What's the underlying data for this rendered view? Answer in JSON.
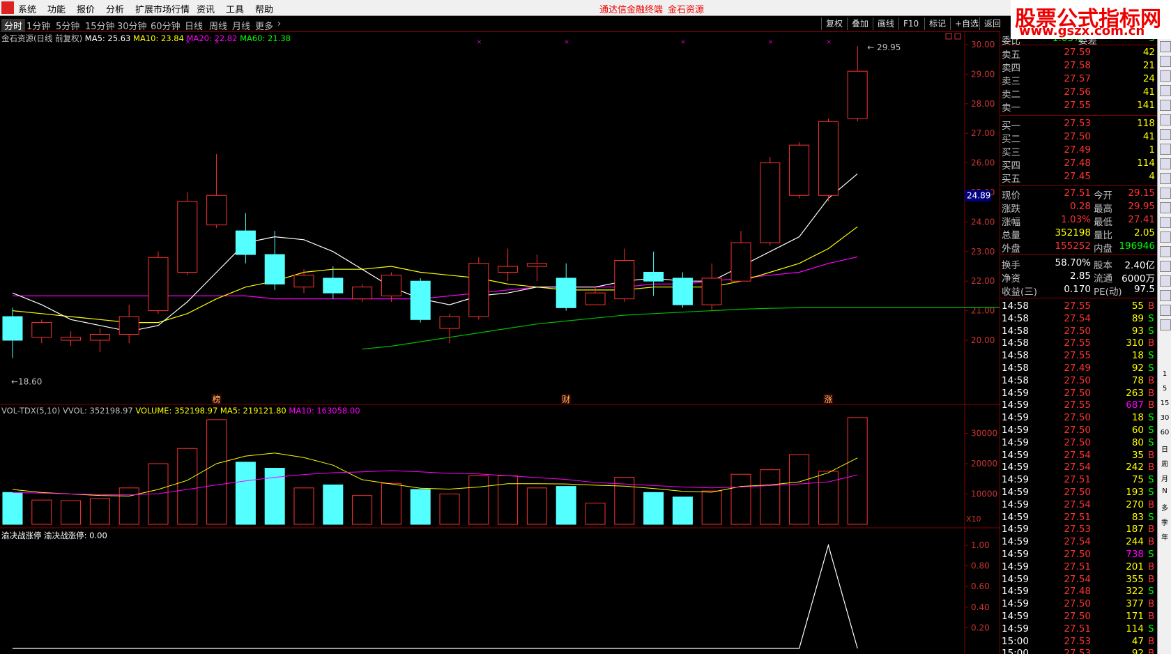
{
  "menu": [
    "系统",
    "功能",
    "报价",
    "分析",
    "扩展市场行情",
    "资讯",
    "工具",
    "帮助"
  ],
  "menu_center": [
    "通达信金融终端",
    "金石资源"
  ],
  "watermark": {
    "line1": "股票公式指标网",
    "line2": "www.gszx.com.cn"
  },
  "tabs": [
    "分时",
    "1分钟",
    "5分钟",
    "15分钟",
    "30分钟",
    "60分钟",
    "日线",
    "周线",
    "月线",
    "更多"
  ],
  "toolbar": [
    "复权",
    "叠加",
    "画线",
    "F10",
    "标记",
    "+自选",
    "返回"
  ],
  "main_info": {
    "title": "金石资源(日线 前复权)",
    "ma5": "MA5: 25.63",
    "ma10": "MA10: 23.84",
    "ma20": "MA20: 22.82",
    "ma60": "MA60: 21.38"
  },
  "vol_info": {
    "name": "VOL-TDX(5,10)",
    "vvol": "VVOL: 352198.97",
    "volume": "VOLUME: 352198.97",
    "ma5": "MA5: 219121.80",
    "ma10": "MA10: 163058.00"
  },
  "ind_info": {
    "name": "渝决战涨停",
    "value": "渝决战涨停: 0.00"
  },
  "price_axis": [
    "30.00",
    "29.00",
    "28.00",
    "27.00",
    "26.00",
    "25.00",
    "24.00",
    "23.00",
    "22.00",
    "21.00",
    "20.00"
  ],
  "vol_axis": [
    "30000",
    "20000",
    "10000"
  ],
  "vol_unit": "X10",
  "ind_axis": [
    "1.00",
    "0.80",
    "0.60",
    "0.40",
    "0.20"
  ],
  "cur_price_tag": "24.89",
  "high_label": "29.95",
  "low_label": "18.60",
  "markers": [
    "榜",
    "财",
    "涨"
  ],
  "chart_data": {
    "type": "candlestick",
    "y_range": [
      19.3,
      30.2
    ],
    "candles": [
      [
        20.8,
        20.0,
        21.1,
        19.4
      ],
      [
        20.1,
        20.6,
        20.7,
        19.9
      ],
      [
        20.0,
        20.1,
        20.3,
        19.8
      ],
      [
        20.0,
        20.2,
        20.4,
        19.6
      ],
      [
        20.2,
        20.8,
        21.2,
        19.9
      ],
      [
        21.0,
        22.8,
        23.0,
        20.9
      ],
      [
        22.3,
        24.7,
        25.0,
        22.2
      ],
      [
        23.9,
        24.9,
        26.3,
        23.8
      ],
      [
        23.7,
        22.9,
        24.3,
        22.6
      ],
      [
        22.9,
        21.9,
        23.7,
        21.7
      ],
      [
        21.8,
        22.2,
        22.4,
        21.6
      ],
      [
        22.1,
        21.6,
        22.5,
        21.4
      ],
      [
        21.4,
        21.8,
        21.9,
        21.3
      ],
      [
        21.5,
        22.2,
        22.3,
        21.3
      ],
      [
        22.0,
        20.7,
        22.1,
        20.6
      ],
      [
        20.4,
        20.8,
        20.9,
        19.9
      ],
      [
        20.8,
        22.6,
        22.8,
        20.7
      ],
      [
        22.3,
        22.5,
        23.1,
        22.0
      ],
      [
        22.5,
        22.6,
        22.9,
        22.0
      ],
      [
        22.1,
        21.1,
        22.6,
        21.0
      ],
      [
        21.2,
        21.6,
        21.8,
        21.2
      ],
      [
        21.4,
        22.7,
        23.1,
        21.3
      ],
      [
        22.3,
        22.0,
        23.0,
        21.5
      ],
      [
        22.1,
        21.2,
        22.3,
        21.1
      ],
      [
        21.2,
        22.1,
        22.6,
        21.0
      ],
      [
        22.0,
        23.3,
        23.7,
        22.0
      ],
      [
        23.3,
        26.0,
        26.2,
        23.2
      ],
      [
        24.9,
        26.6,
        26.7,
        24.8
      ],
      [
        24.9,
        27.4,
        27.5,
        24.7
      ],
      [
        27.5,
        29.1,
        29.95,
        27.4
      ]
    ],
    "ma5": [
      21.6,
      21.2,
      20.7,
      20.5,
      20.3,
      20.5,
      21.3,
      22.3,
      23.3,
      23.5,
      23.4,
      23.0,
      22.4,
      21.8,
      21.4,
      21.2,
      21.5,
      21.6,
      21.8,
      21.8,
      21.8,
      22.0,
      22.1,
      22.0,
      22.0,
      22.5,
      23.0,
      23.5,
      24.8,
      25.63
    ],
    "ma10": [
      21.0,
      20.9,
      20.8,
      20.7,
      20.6,
      20.6,
      20.9,
      21.4,
      21.8,
      22.0,
      22.3,
      22.4,
      22.4,
      22.5,
      22.3,
      22.2,
      22.1,
      21.9,
      21.8,
      21.7,
      21.7,
      21.7,
      21.8,
      21.8,
      21.8,
      22.0,
      22.3,
      22.6,
      23.1,
      23.84
    ],
    "ma20": [
      21.5,
      21.5,
      21.5,
      21.5,
      21.5,
      21.5,
      21.5,
      21.5,
      21.5,
      21.4,
      21.4,
      21.4,
      21.4,
      21.4,
      21.4,
      21.5,
      21.6,
      21.7,
      21.8,
      21.8,
      21.8,
      21.8,
      21.9,
      21.9,
      22.0,
      22.1,
      22.2,
      22.3,
      22.6,
      22.82
    ],
    "ma60_start": 12,
    "ma60": [
      19.7,
      19.8,
      19.95,
      20.1,
      20.25,
      20.4,
      20.55,
      20.65,
      20.75,
      20.85,
      20.9,
      20.95,
      21.0,
      21.05,
      21.08,
      21.1,
      21.1,
      21.1,
      21.1,
      21.1,
      21.1,
      21.1,
      21.12,
      21.15,
      21.2,
      21.25,
      21.3,
      21.38
    ],
    "volume": [
      10.5,
      8.0,
      7.8,
      8.5,
      12.0,
      20.0,
      25.0,
      34.5,
      20.5,
      18.5,
      12.0,
      13.0,
      9.5,
      13.5,
      11.5,
      10.0,
      16.0,
      16.0,
      12.0,
      12.5,
      7.0,
      15.5,
      10.5,
      9.0,
      11.0,
      16.5,
      18.0,
      23.0,
      17.5,
      35.2
    ],
    "vol_ma5": [
      11.5,
      10.5,
      10.0,
      9.5,
      9.3,
      11.5,
      14.5,
      20.0,
      22.5,
      23.5,
      22.0,
      19.5,
      14.7,
      13.3,
      11.9,
      11.6,
      12.3,
      13.4,
      13.4,
      13.3,
      12.9,
      12.6,
      11.8,
      10.9,
      10.6,
      12.5,
      13.0,
      14.0,
      17.0,
      21.9
    ],
    "vol_ma10": [
      10.5,
      10.3,
      10.0,
      9.8,
      9.7,
      10.1,
      11.5,
      13.0,
      14.3,
      15.5,
      16.4,
      17.0,
      17.3,
      17.7,
      17.3,
      16.8,
      16.6,
      16.0,
      15.4,
      14.8,
      13.8,
      13.3,
      12.8,
      12.3,
      12.0,
      12.3,
      12.8,
      13.3,
      14.0,
      16.3
    ],
    "indicator": [
      0,
      0,
      0,
      0,
      0,
      0,
      0,
      0,
      0,
      0,
      0,
      0,
      0,
      0,
      0,
      0,
      0,
      0,
      0,
      0,
      0,
      0,
      0,
      0,
      0,
      0,
      0,
      0,
      1,
      0
    ]
  },
  "quote": {
    "header": [
      "委比",
      "-1.03%",
      "委差",
      "-5"
    ],
    "sell": [
      [
        "卖五",
        "27.59",
        "42"
      ],
      [
        "卖四",
        "27.58",
        "21"
      ],
      [
        "卖三",
        "27.57",
        "24"
      ],
      [
        "卖二",
        "27.56",
        "41"
      ],
      [
        "卖一",
        "27.55",
        "141"
      ]
    ],
    "buy": [
      [
        "买一",
        "27.53",
        "118"
      ],
      [
        "买二",
        "27.50",
        "41"
      ],
      [
        "买三",
        "27.49",
        "1"
      ],
      [
        "买四",
        "27.48",
        "114"
      ],
      [
        "买五",
        "27.45",
        "4"
      ]
    ],
    "stats": [
      [
        "现价",
        "27.51",
        "今开",
        "29.15"
      ],
      [
        "涨跌",
        "0.28",
        "最高",
        "29.95"
      ],
      [
        "涨幅",
        "1.03%",
        "最低",
        "27.41"
      ],
      [
        "总量",
        "352198",
        "量比",
        "2.05"
      ],
      [
        "外盘",
        "155252",
        "内盘",
        "196946"
      ]
    ],
    "stats2": [
      [
        "换手",
        "58.70%",
        "股本",
        "2.40亿"
      ],
      [
        "净资",
        "2.85",
        "流通",
        "6000万"
      ],
      [
        "收益(三)",
        "0.170",
        "PE(动)",
        "97.5"
      ]
    ]
  },
  "ticks": [
    [
      "14:58",
      "27.55",
      "55",
      "B"
    ],
    [
      "14:58",
      "27.54",
      "89",
      "S"
    ],
    [
      "14:58",
      "27.50",
      "93",
      "S"
    ],
    [
      "14:58",
      "27.55",
      "310",
      "B"
    ],
    [
      "14:58",
      "27.55",
      "18",
      "S"
    ],
    [
      "14:58",
      "27.49",
      "92",
      "S"
    ],
    [
      "14:58",
      "27.50",
      "78",
      "B"
    ],
    [
      "14:59",
      "27.50",
      "263",
      "B"
    ],
    [
      "14:59",
      "27.55",
      "687",
      "B"
    ],
    [
      "14:59",
      "27.50",
      "18",
      "S"
    ],
    [
      "14:59",
      "27.50",
      "60",
      "S"
    ],
    [
      "14:59",
      "27.50",
      "80",
      "S"
    ],
    [
      "14:59",
      "27.54",
      "35",
      "B"
    ],
    [
      "14:59",
      "27.54",
      "242",
      "B"
    ],
    [
      "14:59",
      "27.51",
      "75",
      "S"
    ],
    [
      "14:59",
      "27.50",
      "193",
      "S"
    ],
    [
      "14:59",
      "27.54",
      "270",
      "B"
    ],
    [
      "14:59",
      "27.51",
      "83",
      "S"
    ],
    [
      "14:59",
      "27.53",
      "187",
      "B"
    ],
    [
      "14:59",
      "27.54",
      "244",
      "B"
    ],
    [
      "14:59",
      "27.50",
      "738",
      "S"
    ],
    [
      "14:59",
      "27.51",
      "201",
      "B"
    ],
    [
      "14:59",
      "27.54",
      "355",
      "B"
    ],
    [
      "14:59",
      "27.48",
      "322",
      "S"
    ],
    [
      "14:59",
      "27.50",
      "377",
      "B"
    ],
    [
      "14:59",
      "27.50",
      "171",
      "B"
    ],
    [
      "14:59",
      "27.51",
      "114",
      "S"
    ],
    [
      "15:00",
      "27.53",
      "47",
      "B"
    ],
    [
      "15:00",
      "27.53",
      "92",
      "B"
    ]
  ],
  "side_icons": [
    "1",
    "5",
    "15",
    "30",
    "60",
    "日",
    "周",
    "月",
    "N",
    "多",
    "季",
    "年"
  ]
}
